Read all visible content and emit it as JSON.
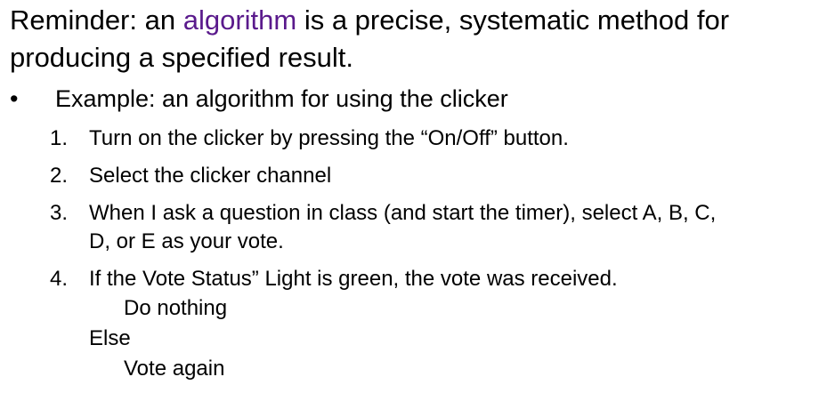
{
  "title": {
    "prefix": "Reminder: an ",
    "keyword": "algorithm",
    "suffix_line1": " is a precise, systematic method for",
    "line2": "producing a specified result."
  },
  "bullet": {
    "symbol": "•",
    "text": "Example: an algorithm for using the clicker"
  },
  "steps": [
    {
      "num": "1.",
      "lines": [
        "Turn on the clicker by pressing the “On/Off” button."
      ]
    },
    {
      "num": "2.",
      "lines": [
        "Select the clicker channel"
      ]
    },
    {
      "num": "3.",
      "lines": [
        "When I ask a question in class (and start the timer), select A, B, C,",
        "D, or E as your vote."
      ]
    },
    {
      "num": "4.",
      "lines": [
        "If the  Vote Status” Light is green, the vote was received."
      ]
    }
  ],
  "conditional": {
    "then_action": "Do nothing",
    "else_label": "Else",
    "else_action": "Vote again"
  },
  "colors": {
    "keyword": "#5a1a8c",
    "text": "#000000",
    "background": "#ffffff"
  }
}
